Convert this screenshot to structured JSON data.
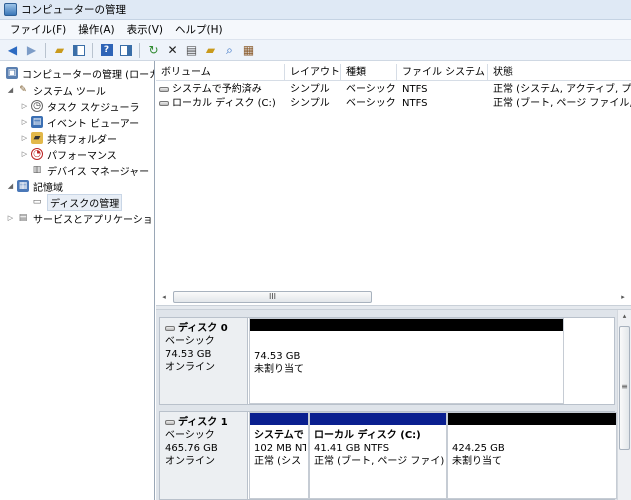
{
  "window": {
    "title": "コンピューターの管理"
  },
  "menu": [
    "ファイル(F)",
    "操作(A)",
    "表示(V)",
    "ヘルプ(H)"
  ],
  "toolbar": [
    "back-icon",
    "forward-icon",
    "up-folder-icon",
    "show-hide-tree-icon",
    "help-icon",
    "properties-pane-icon",
    "refresh-icon",
    "delete-icon",
    "properties-icon",
    "open-icon",
    "search-icon",
    "settings-icon"
  ],
  "tree": {
    "root": "コンピューターの管理 (ローカ",
    "system_tools": "システム ツール",
    "task_scheduler": "タスク スケジューラ",
    "event_viewer": "イベント ビューアー",
    "shared_folders": "共有フォルダー",
    "performance": "パフォーマンス",
    "device_manager": "デバイス マネージャー",
    "storage": "記憶域",
    "disk_management": "ディスクの管理",
    "services_apps": "サービスとアプリケーショ"
  },
  "volumes": {
    "headers": [
      "ボリューム",
      "レイアウト",
      "種類",
      "ファイル システム",
      "状態"
    ],
    "rows": [
      [
        "システムで予約済み",
        "シンプル",
        "ベーシック",
        "NTFS",
        "正常 (システム, アクティブ, プラ"
      ],
      [
        "ローカル ディスク (C:)",
        "シンプル",
        "ベーシック",
        "NTFS",
        "正常 (ブート, ページ ファイル,"
      ]
    ]
  },
  "scroll": {
    "thumb_label": "III",
    "v_thumb_label": "≡"
  },
  "disks": [
    {
      "name": "ディスク 0",
      "type": "ベーシック",
      "size": "74.53 GB",
      "status": "オンライン",
      "partitions": [
        {
          "title": "",
          "line1": "74.53 GB",
          "line2": "未割り当て",
          "bar_color": "#000000"
        }
      ]
    },
    {
      "name": "ディスク 1",
      "type": "ベーシック",
      "size": "465.76 GB",
      "status": "オンライン",
      "partitions": [
        {
          "title": "システムで",
          "line1": "102 MB NT",
          "line2": "正常 (シス",
          "bar_color": "#0a1f8f"
        },
        {
          "title": "ローカル ディスク (C:)",
          "line1": "41.41 GB NTFS",
          "line2": "正常 (ブート, ページ ファイ)",
          "bar_color": "#0a1f8f"
        },
        {
          "title": "",
          "line1": "424.25 GB",
          "line2": "未割り当て",
          "bar_color": "#000000"
        }
      ]
    }
  ]
}
